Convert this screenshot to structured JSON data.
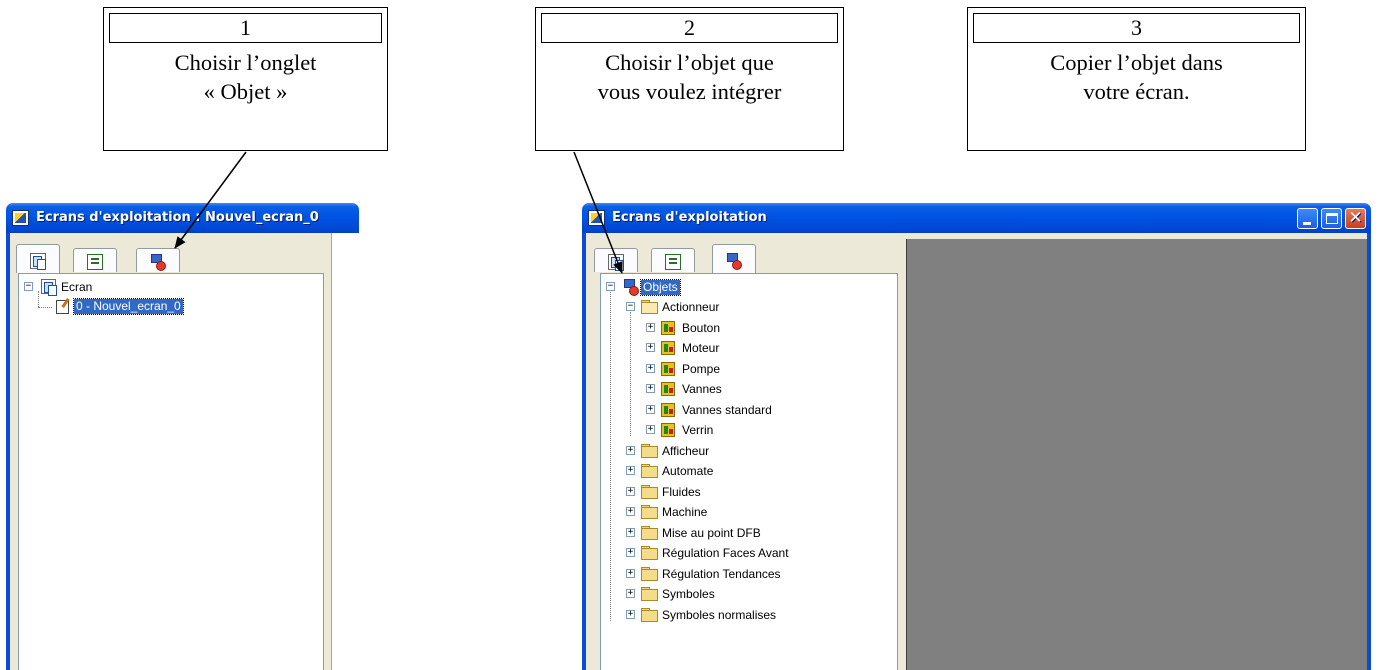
{
  "callouts": [
    {
      "number": "1",
      "line1": "Choisir l’onglet",
      "line2": "« Objet »"
    },
    {
      "number": "2",
      "line1": "Choisir l’objet que",
      "line2": "vous voulez intégrer"
    },
    {
      "number": "3",
      "line1": "Copier l’objet dans",
      "line2": "votre écran."
    }
  ],
  "left_window": {
    "title": "Ecrans d'exploitation : Nouvel_ecran_0",
    "tabs": [
      "screens-icon",
      "list-icon",
      "objects-icon"
    ],
    "active_tab": "screens",
    "tree": {
      "root": {
        "label": "Ecran",
        "expanded": true
      },
      "children": [
        {
          "label": "0 - Nouvel_ecran_0",
          "selected": true
        }
      ]
    },
    "scroll_button": "<"
  },
  "right_window": {
    "title": "Ecrans d'exploitation",
    "caption_buttons": [
      "minimize",
      "maximize",
      "close"
    ],
    "close_glyph": "✕",
    "tabs": [
      "screens-icon",
      "list-icon",
      "objects-icon"
    ],
    "active_tab": "objects",
    "tree": {
      "root": {
        "label": "Objets",
        "selected": true,
        "expanded": true
      },
      "actionneur": {
        "label": "Actionneur",
        "expanded": true,
        "children": [
          "Bouton",
          "Moteur",
          "Pompe",
          "Vannes",
          "Vannes standard",
          "Verrin"
        ]
      },
      "folders": [
        "Afficheur",
        "Automate",
        "Fluides",
        "Machine",
        "Mise au point DFB",
        "Régulation Faces Avant",
        "Régulation Tendances",
        "Symboles",
        "Symboles normalises"
      ]
    }
  },
  "colors": {
    "titlebar": "#0054e3",
    "selection": "#316ac5",
    "workspace": "#808080",
    "panel": "#ece9d8"
  }
}
